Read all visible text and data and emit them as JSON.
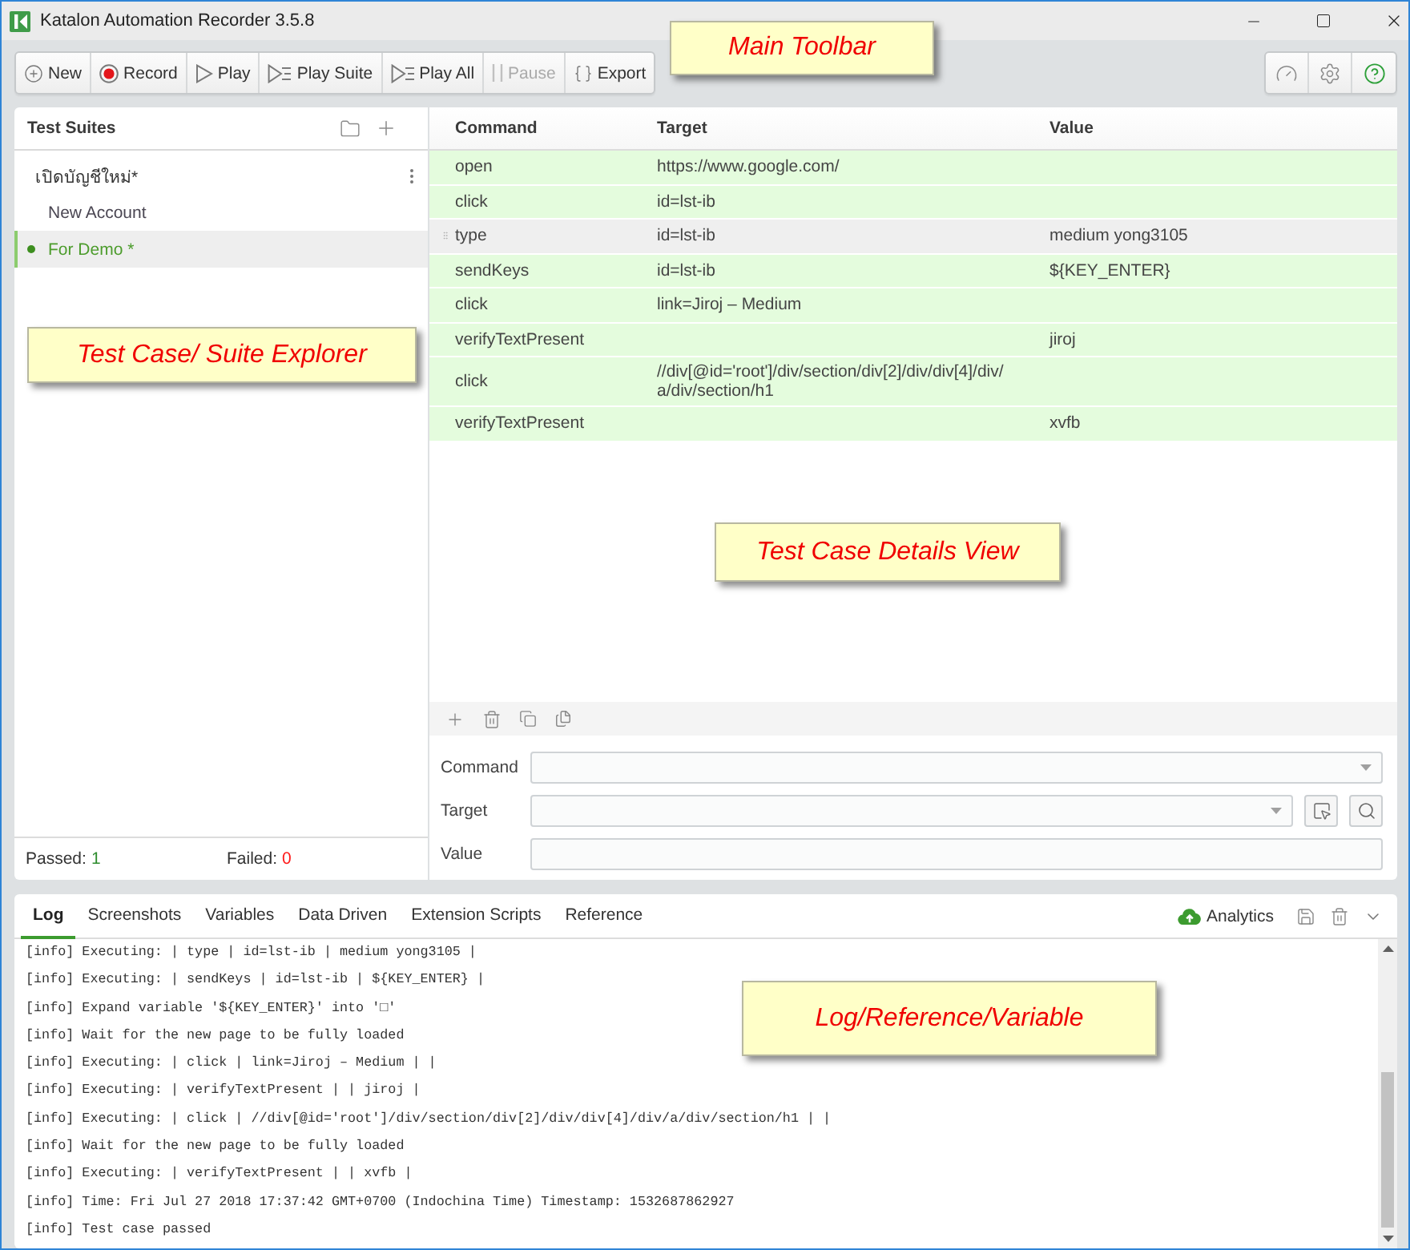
{
  "window": {
    "title": "Katalon Automation Recorder 3.5.8"
  },
  "toolbar": {
    "callout": "Main Toolbar",
    "buttons": [
      {
        "kind": "new",
        "label": "New",
        "disabled": false
      },
      {
        "kind": "record",
        "label": "Record",
        "disabled": false
      },
      {
        "kind": "play",
        "label": "Play",
        "disabled": false
      },
      {
        "kind": "play_suite",
        "label": "Play Suite",
        "disabled": false
      },
      {
        "kind": "play_all",
        "label": "Play All",
        "disabled": false
      },
      {
        "kind": "pause",
        "label": "Pause",
        "disabled": true
      },
      {
        "kind": "export",
        "label": "Export",
        "disabled": false
      }
    ]
  },
  "explorer": {
    "title": "Test Suites",
    "callout": "Test Case/ Suite Explorer",
    "suites": [
      {
        "name": "เปิดบัญชีใหม่*",
        "children": [
          {
            "name": "New Account",
            "selected": false
          },
          {
            "name": "For Demo *",
            "selected": true
          }
        ]
      }
    ],
    "footer": {
      "passed_label": "Passed:",
      "passed_count": "1",
      "failed_label": "Failed:",
      "failed_count": "0"
    }
  },
  "test_case": {
    "callout": "Test Case Details View",
    "columns": [
      "Command",
      "Target",
      "Value"
    ],
    "rows": [
      {
        "command": "open",
        "target": "https://www.google.com/",
        "passed": true,
        "selected": false
      },
      {
        "command": "click",
        "target": "id=lst-ib",
        "passed": true,
        "selected": false
      },
      {
        "command": "type",
        "target": "id=lst-ib",
        "value": "medium yong3105",
        "passed": true,
        "selected": true
      },
      {
        "command": "sendKeys",
        "target": "id=lst-ib",
        "value": "${KEY_ENTER}",
        "passed": true,
        "selected": false
      },
      {
        "command": "click",
        "target": "link=Jiroj – Medium",
        "passed": true,
        "selected": false
      },
      {
        "command": "verifyTextPresent",
        "value": "jiroj",
        "passed": true,
        "selected": false
      },
      {
        "command": "click",
        "target": "//div[@id='root']/div/section/div[2]/div/div[4]/div/a/div/section/h1",
        "passed": true,
        "selected": false
      },
      {
        "command": "verifyTextPresent",
        "value": "xvfb",
        "passed": true,
        "selected": false
      }
    ]
  },
  "editor": {
    "fields": [
      {
        "kind": "select",
        "label": "Command"
      },
      {
        "kind": "target",
        "label": "Target"
      },
      {
        "kind": "text",
        "label": "Value"
      }
    ]
  },
  "log_panel": {
    "callout": "Log/Reference/Variable",
    "tabs": [
      {
        "label": "Log",
        "selected": true
      },
      {
        "label": "Screenshots",
        "selected": false
      },
      {
        "label": "Variables",
        "selected": false
      },
      {
        "label": "Data Driven",
        "selected": false
      },
      {
        "label": "Extension Scripts",
        "selected": false
      },
      {
        "label": "Reference",
        "selected": false
      }
    ],
    "analytics": "Analytics",
    "lines": [
      "[info] Executing: | type | id=lst-ib | medium yong3105 |",
      "[info] Executing: | sendKeys | id=lst-ib | ${KEY_ENTER} |",
      "[info] Expand variable '${KEY_ENTER}' into '□'",
      "[info] Wait for the new page to be fully loaded",
      "[info] Executing: | click | link=Jiroj – Medium | |",
      "[info] Executing: | verifyTextPresent | | jiroj |",
      "[info] Executing: | click | //div[@id='root']/div/section/div[2]/div/div[4]/div/a/div/section/h1 | |",
      "[info] Wait for the new page to be fully loaded",
      "[info] Executing: | verifyTextPresent | | xvfb |",
      "[info] Time: Fri Jul 27 2018 17:37:42 GMT+0700 (Indochina Time) Timestamp: 1532687862927",
      "[info] Test case passed"
    ]
  }
}
